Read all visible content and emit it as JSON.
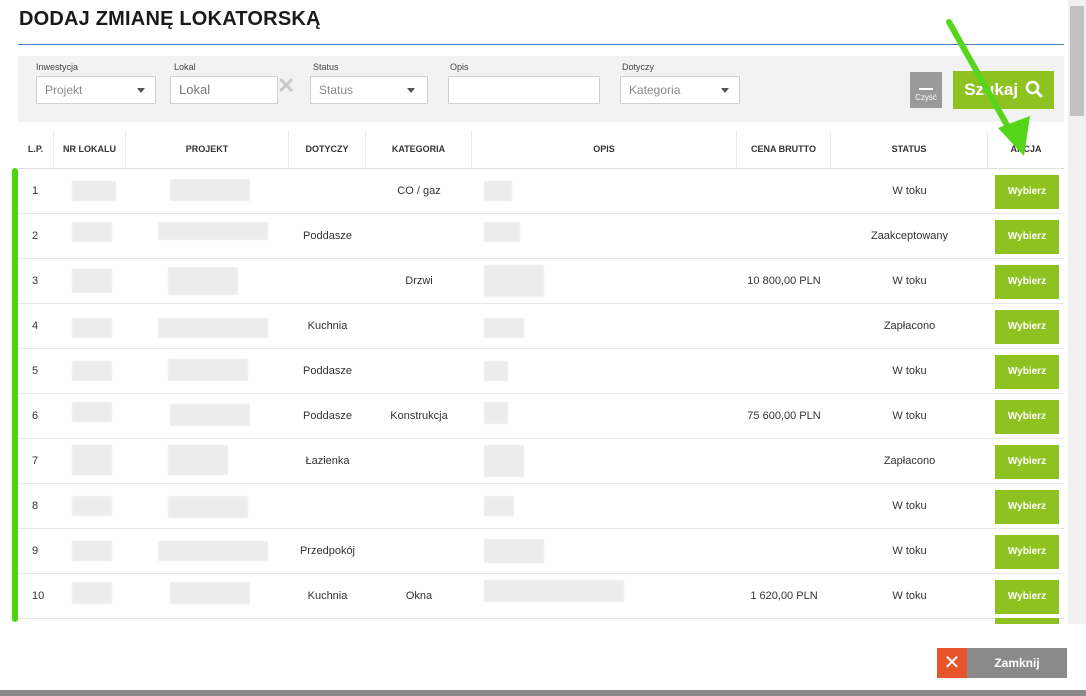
{
  "title": "DODAJ ZMIANĘ LOKATORSKĄ",
  "filters": {
    "inwestycja": {
      "label": "Inwestycja",
      "value": "Projekt"
    },
    "lokal": {
      "label": "Lokal",
      "value": "Lokal"
    },
    "status": {
      "label": "Status",
      "value": "Status"
    },
    "opis": {
      "label": "Opis",
      "value": ""
    },
    "dotyczy": {
      "label": "Dotyczy",
      "value": "Kategoria"
    },
    "clear_label": "Czyść",
    "search_label": "Szukaj"
  },
  "columns": [
    "L.P.",
    "NR LOKALU",
    "PROJEKT",
    "DOTYCZY",
    "KATEGORIA",
    "OPIS",
    "CENA BRUTTO",
    "STATUS",
    "AKCJA"
  ],
  "rows": [
    {
      "lp": "1",
      "dotyczy": "",
      "kategoria": "CO / gaz",
      "cena": "",
      "status": "W toku",
      "akcja": "Wybierz"
    },
    {
      "lp": "2",
      "dotyczy": "Poddasze",
      "kategoria": "",
      "cena": "",
      "status": "Zaakceptowany",
      "akcja": "Wybierz"
    },
    {
      "lp": "3",
      "dotyczy": "",
      "kategoria": "Drzwi",
      "cena": "10 800,00 PLN",
      "status": "W toku",
      "akcja": "Wybierz"
    },
    {
      "lp": "4",
      "dotyczy": "Kuchnia",
      "kategoria": "",
      "cena": "",
      "status": "Zapłacono",
      "akcja": "Wybierz"
    },
    {
      "lp": "5",
      "dotyczy": "Poddasze",
      "kategoria": "",
      "cena": "",
      "status": "W toku",
      "akcja": "Wybierz"
    },
    {
      "lp": "6",
      "dotyczy": "Poddasze",
      "kategoria": "Konstrukcja",
      "cena": "75 600,00 PLN",
      "status": "W toku",
      "akcja": "Wybierz"
    },
    {
      "lp": "7",
      "dotyczy": "Łazienka",
      "kategoria": "",
      "cena": "",
      "status": "Zapłacono",
      "akcja": "Wybierz"
    },
    {
      "lp": "8",
      "dotyczy": "",
      "kategoria": "",
      "cena": "",
      "status": "W toku",
      "akcja": "Wybierz"
    },
    {
      "lp": "9",
      "dotyczy": "Przedpokój",
      "kategoria": "",
      "cena": "",
      "status": "W toku",
      "akcja": "Wybierz"
    },
    {
      "lp": "10",
      "dotyczy": "Kuchnia",
      "kategoria": "Okna",
      "cena": "1 620,00 PLN",
      "status": "W toku",
      "akcja": "Wybierz"
    }
  ],
  "footer": {
    "close_label": "Zamknij"
  },
  "colors": {
    "accent_green": "#8ec220",
    "close_red": "#e8542a",
    "annotation_green": "#4cd612"
  },
  "icons": [
    "search-icon",
    "close-x-icon",
    "clear-x-icon",
    "chevron-down-icon",
    "annotation-arrow-icon"
  ]
}
